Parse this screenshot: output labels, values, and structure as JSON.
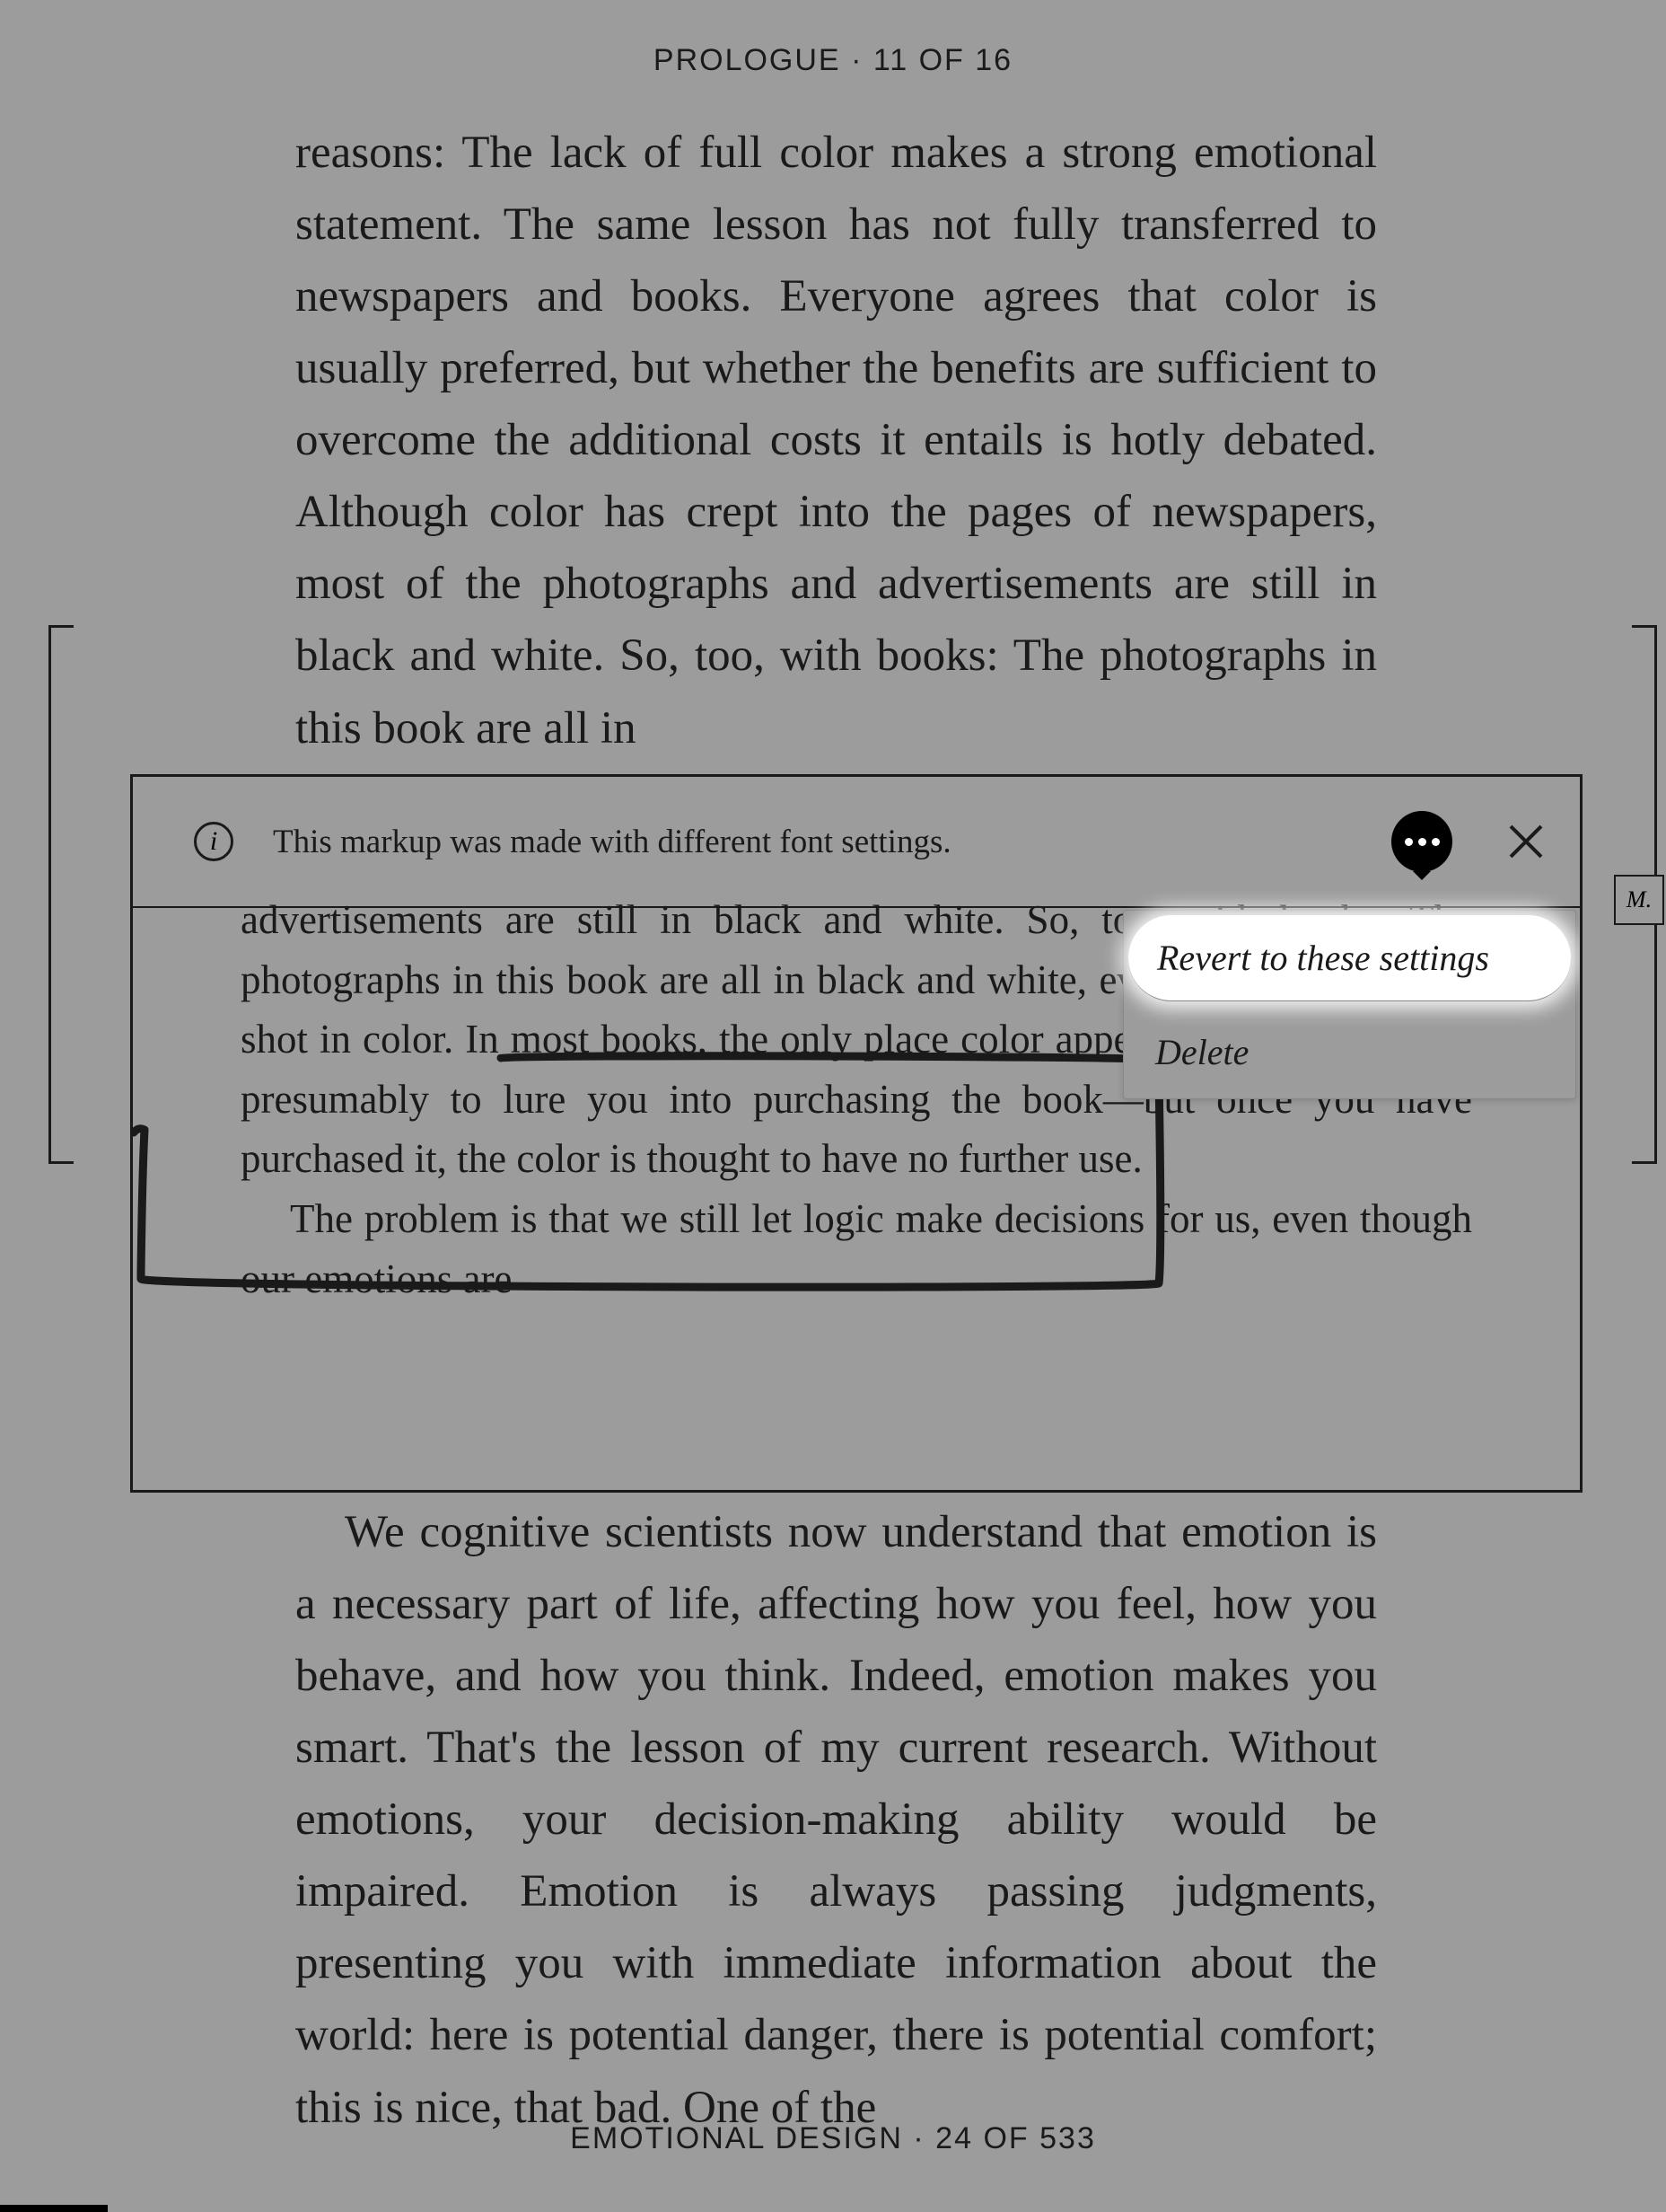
{
  "header": {
    "chapter": "PROLOGUE",
    "separator": "·",
    "page_current": 11,
    "page_total": 16
  },
  "footer": {
    "title": "EMOTIONAL DESIGN",
    "separator": "·",
    "page_current": 24,
    "page_total": 533
  },
  "main_paragraph_1": "reasons: The lack of full color makes a strong emotional statement. The same lesson has not fully transferred to newspapers and books. Everyone agrees that color is usually preferred, but whether the benefits are sufficient to overcome the additional costs it entails is hotly debated. Although color has crept into the pages of newspapers, most of the photographs and advertisements are still in black and white. So, too, with books: The photographs in this book are all in",
  "markup": {
    "message": "This markup was made with different font settings.",
    "body_p1": "advertisements are still in black and white. So, too, with books: The photographs in this book are all in black and white, even though they were shot in color. In most books, the only place color appears is on the cover— presumably to lure you into purchasing the book—but once you have purchased it, the color is thought to have no further use.",
    "body_p2": "The problem is that we still let logic make decisions for us, even though our emotions are",
    "menu": {
      "revert": "Revert to these settings",
      "delete": "Delete"
    }
  },
  "lower_paragraph": "We cognitive scientists now understand that emotion is a necessary part of life, affecting how you feel, how you behave, and how you think. Indeed, emotion makes you smart. That's the lesson of my current research. Without emotions, your decision-making ability would be impaired. Emotion is always passing judgments, presenting you with immediate information about the world: here is potential danger, there is potential comfort; this is nice, that bad. One of the",
  "signature": "M."
}
